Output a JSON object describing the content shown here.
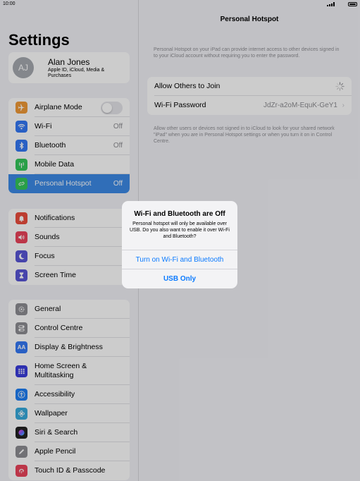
{
  "status": {
    "time": "10:00"
  },
  "sidebar": {
    "title": "Settings",
    "profile": {
      "initials": "AJ",
      "name": "Alan Jones",
      "subtitle": "Apple ID, iCloud, Media & Purchases"
    },
    "group1": [
      {
        "label": "Airplane Mode",
        "icon": "airplane-icon",
        "color": "#f09a37"
      },
      {
        "label": "Wi-Fi",
        "value": "Off",
        "icon": "wifi-icon",
        "color": "#3478f6"
      },
      {
        "label": "Bluetooth",
        "value": "Off",
        "icon": "bluetooth-icon",
        "color": "#3478f6"
      },
      {
        "label": "Mobile Data",
        "icon": "antenna-icon",
        "color": "#34c759"
      },
      {
        "label": "Personal Hotspot",
        "value": "Off",
        "icon": "hotspot-icon",
        "color": "#34c759"
      }
    ],
    "group2": [
      {
        "label": "Notifications",
        "icon": "bell-icon",
        "color": "#eb4d3d"
      },
      {
        "label": "Sounds",
        "icon": "speaker-icon",
        "color": "#eb445a"
      },
      {
        "label": "Focus",
        "icon": "moon-icon",
        "color": "#5856d6"
      },
      {
        "label": "Screen Time",
        "icon": "hourglass-icon",
        "color": "#5856d6"
      }
    ],
    "group3": [
      {
        "label": "General",
        "icon": "gear-icon",
        "color": "#8e8e93"
      },
      {
        "label": "Control Centre",
        "icon": "switches-icon",
        "color": "#8e8e93"
      },
      {
        "label": "Display & Brightness",
        "icon": "aa-icon",
        "color": "#3478f6"
      },
      {
        "label": "Home Screen & Multitasking",
        "icon": "grid-icon",
        "color": "#3a3ddc"
      },
      {
        "label": "Accessibility",
        "icon": "accessibility-icon",
        "color": "#1d7ff5"
      },
      {
        "label": "Wallpaper",
        "icon": "flower-icon",
        "color": "#36aadc"
      },
      {
        "label": "Siri & Search",
        "icon": "siri-icon",
        "color": "#222222"
      },
      {
        "label": "Apple Pencil",
        "icon": "pencil-icon",
        "color": "#8e8e93"
      },
      {
        "label": "Touch ID & Passcode",
        "icon": "fingerprint-icon",
        "color": "#eb445a"
      }
    ]
  },
  "detail": {
    "title": "Personal Hotspot",
    "top_text": "Personal Hotspot on your iPad can provide internet access to other devices signed in to your iCloud account without requiring you to enter the password.",
    "allow_label": "Allow Others to Join",
    "wifi_password_label": "Wi-Fi Password",
    "wifi_password_value": "JdZr-a2oM-EquK-GeY1",
    "bottom_text": "Allow other users or devices not signed in to iCloud to look for your shared network \"iPad\" when you are in Personal Hotspot settings or when you turn it on in Control Centre."
  },
  "alert": {
    "title": "Wi-Fi and Bluetooth are Off",
    "message": "Personal hotspot will only be available over USB. Do you also want to enable it over Wi-Fi and Bluetooth?",
    "button_primary": "Turn on Wi-Fi and Bluetooth",
    "button_secondary": "USB Only"
  }
}
